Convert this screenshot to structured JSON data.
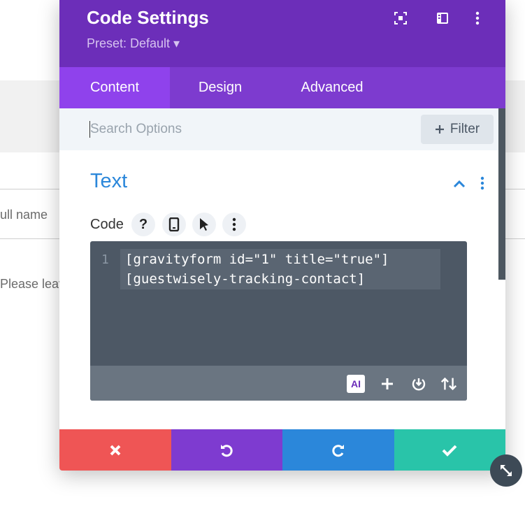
{
  "background": {
    "field_label_partial": "ull name",
    "message_partial": "Please leav"
  },
  "modal": {
    "title": "Code Settings",
    "preset": "Preset: Default ▾",
    "header_icons": [
      "focus-icon",
      "split-view-icon",
      "more-vertical-icon"
    ],
    "tabs": [
      {
        "label": "Content",
        "active": true
      },
      {
        "label": "Design",
        "active": false
      },
      {
        "label": "Advanced",
        "active": false
      }
    ],
    "search": {
      "placeholder": "Search Options",
      "value": ""
    },
    "filter_label": "Filter",
    "section": {
      "title": "Text",
      "expanded": true
    },
    "field": {
      "label": "Code",
      "help_label": "?",
      "code_lines": [
        {
          "number": "1",
          "text": "[gravityform id=\"1\" title=\"true\"]"
        },
        {
          "number": "",
          "text": "[guestwisely-tracking-contact]"
        }
      ],
      "toolbar": {
        "ai_label": "AI"
      }
    },
    "footer": {
      "colors": {
        "discard": "#ef5555",
        "undo": "#7e3bd0",
        "redo": "#2b87da",
        "save": "#29c4a9"
      }
    }
  },
  "colors": {
    "header": "#6c2eb9",
    "tabs_bar": "#7d3bcf",
    "tab_active": "#8f42ec",
    "accent_blue": "#2b87da",
    "editor_bg": "#4d5865"
  }
}
